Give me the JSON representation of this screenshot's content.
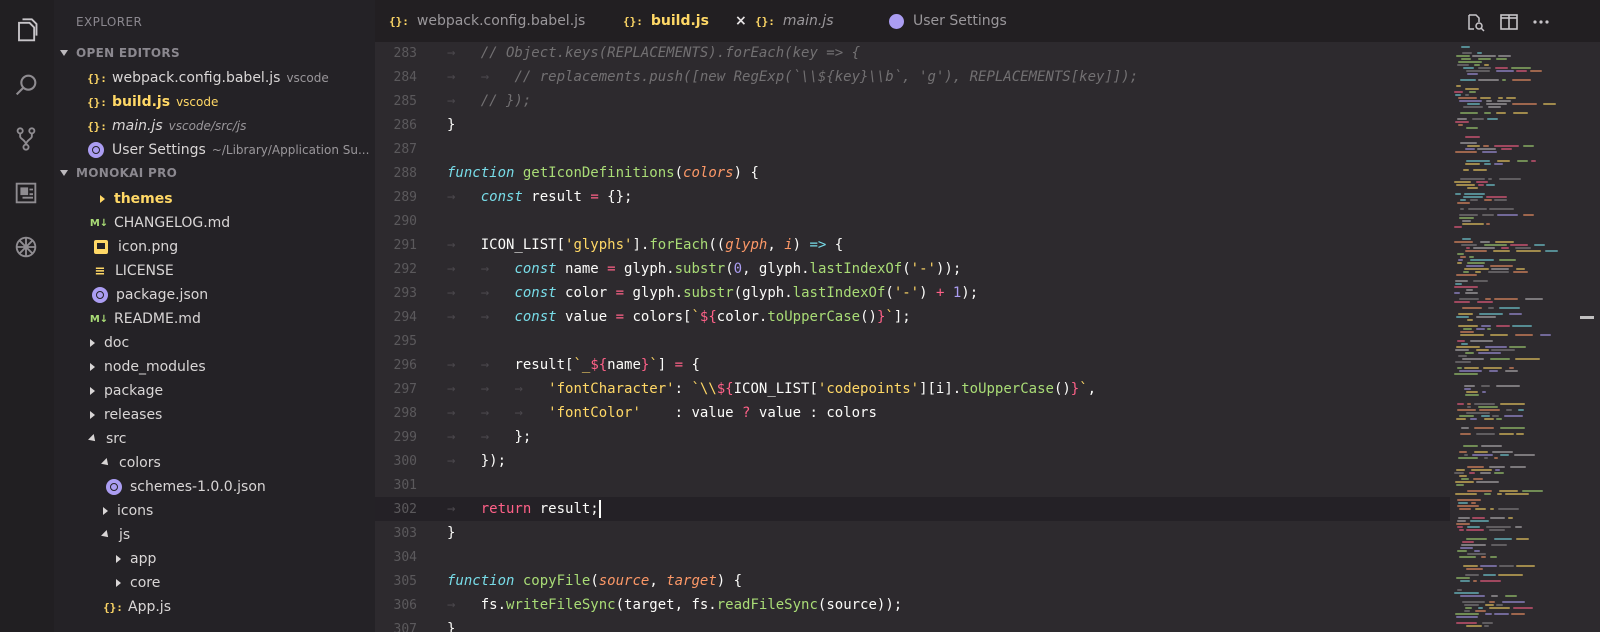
{
  "activity_bar": {
    "icons": [
      "explorer-icon",
      "search-icon",
      "source-control-icon",
      "extensions-icon",
      "debug-icon"
    ]
  },
  "sidebar": {
    "header": "EXPLORER",
    "open_editors": {
      "title": "OPEN EDITORS",
      "items": [
        {
          "icon": "js-file-icon",
          "label": "webpack.config.babel.js",
          "desc": "vscode"
        },
        {
          "icon": "js-file-icon",
          "label": "build.js",
          "desc": "vscode"
        },
        {
          "icon": "js-file-icon",
          "label": "main.js",
          "desc": "vscode/src/js"
        },
        {
          "icon": "settings-file-icon",
          "label": "User Settings",
          "desc": "~/Library/Application Su..."
        }
      ]
    },
    "project": {
      "title": "MONOKAI PRO",
      "items": [
        {
          "label": "themes",
          "icon": "folder-collapsed"
        },
        {
          "label": "CHANGELOG.md",
          "icon": "markdown-file-icon",
          "icon_text": "M↓"
        },
        {
          "label": "icon.png",
          "icon": "image-file-icon"
        },
        {
          "label": "LICENSE",
          "icon": "license-file-icon",
          "icon_text": "≡"
        },
        {
          "label": "package.json",
          "icon": "json-file-icon"
        },
        {
          "label": "README.md",
          "icon": "markdown-file-icon",
          "icon_text": "M↓"
        },
        {
          "label": "doc",
          "icon": "folder-collapsed"
        },
        {
          "label": "node_modules",
          "icon": "folder-collapsed"
        },
        {
          "label": "package",
          "icon": "folder-collapsed"
        },
        {
          "label": "releases",
          "icon": "folder-collapsed"
        },
        {
          "label": "src",
          "icon": "folder-expanded"
        },
        {
          "label": "colors",
          "icon": "folder-expanded"
        },
        {
          "label": "schemes-1.0.0.json",
          "icon": "json-file-icon"
        },
        {
          "label": "icons",
          "icon": "folder-collapsed"
        },
        {
          "label": "js",
          "icon": "folder-expanded"
        },
        {
          "label": "app",
          "icon": "folder-collapsed"
        },
        {
          "label": "core",
          "icon": "folder-collapsed"
        },
        {
          "label": "App.js",
          "icon": "js-file-icon"
        }
      ]
    },
    "js_icon_text": "{}:"
  },
  "tabs": [
    {
      "label": "webpack.config.babel.js",
      "icon": "js-file-icon"
    },
    {
      "label": "build.js",
      "icon": "js-file-icon",
      "active": true,
      "close": "×"
    },
    {
      "label": "main.js",
      "icon": "js-file-icon"
    },
    {
      "label": "User Settings",
      "icon": "settings-file-icon"
    }
  ],
  "toolbar_icons": [
    "open-changes-icon",
    "split-editor-icon",
    "more-actions-icon"
  ],
  "editor": {
    "current_line": 302,
    "lines": [
      {
        "n": 283,
        "indent": 1,
        "tokens": [
          [
            "cmt",
            "// Object.keys(REPLACEMENTS).forEach(key => {"
          ]
        ]
      },
      {
        "n": 284,
        "indent": 2,
        "tokens": [
          [
            "cmt",
            "// replacements.push([new RegExp(`\\\\${key}\\\\b`, 'g'), REPLACEMENTS[key]]);"
          ]
        ]
      },
      {
        "n": 285,
        "indent": 1,
        "tokens": [
          [
            "cmt",
            "// });"
          ]
        ]
      },
      {
        "n": 286,
        "indent": 0,
        "tokens": [
          [
            "var",
            "}"
          ]
        ]
      },
      {
        "n": 287,
        "indent": 0,
        "tokens": []
      },
      {
        "n": 288,
        "indent": 0,
        "tokens": [
          [
            "stor",
            "function"
          ],
          [
            "var",
            " "
          ],
          [
            "fn",
            "getIconDefinitions"
          ],
          [
            "var",
            "("
          ],
          [
            "param",
            "colors"
          ],
          [
            "var",
            ") {"
          ]
        ]
      },
      {
        "n": 289,
        "indent": 1,
        "tokens": [
          [
            "stor",
            "const"
          ],
          [
            "var",
            " result "
          ],
          [
            "op",
            "="
          ],
          [
            "var",
            " {};"
          ]
        ]
      },
      {
        "n": 290,
        "indent": 0,
        "tokens": []
      },
      {
        "n": 291,
        "indent": 1,
        "tokens": [
          [
            "var",
            "ICON_LIST["
          ],
          [
            "str",
            "'glyphs'"
          ],
          [
            "var",
            "]."
          ],
          [
            "fn",
            "forEach"
          ],
          [
            "var",
            "(("
          ],
          [
            "param",
            "glyph"
          ],
          [
            "var",
            ", "
          ],
          [
            "param",
            "i"
          ],
          [
            "var",
            ") "
          ],
          [
            "stor",
            "=>"
          ],
          [
            "var",
            " {"
          ]
        ]
      },
      {
        "n": 292,
        "indent": 2,
        "tokens": [
          [
            "stor",
            "const"
          ],
          [
            "var",
            " name "
          ],
          [
            "op",
            "="
          ],
          [
            "var",
            " glyph."
          ],
          [
            "fn",
            "substr"
          ],
          [
            "var",
            "("
          ],
          [
            "num",
            "0"
          ],
          [
            "var",
            ", glyph."
          ],
          [
            "fn",
            "lastIndexOf"
          ],
          [
            "var",
            "("
          ],
          [
            "str",
            "'-'"
          ],
          [
            "var",
            "));"
          ]
        ]
      },
      {
        "n": 293,
        "indent": 2,
        "tokens": [
          [
            "stor",
            "const"
          ],
          [
            "var",
            " color "
          ],
          [
            "op",
            "="
          ],
          [
            "var",
            " glyph."
          ],
          [
            "fn",
            "substr"
          ],
          [
            "var",
            "(glyph."
          ],
          [
            "fn",
            "lastIndexOf"
          ],
          [
            "var",
            "("
          ],
          [
            "str",
            "'-'"
          ],
          [
            "var",
            ") "
          ],
          [
            "op",
            "+"
          ],
          [
            "var",
            " "
          ],
          [
            "num",
            "1"
          ],
          [
            "var",
            ");"
          ]
        ]
      },
      {
        "n": 294,
        "indent": 2,
        "tokens": [
          [
            "stor",
            "const"
          ],
          [
            "var",
            " value "
          ],
          [
            "op",
            "="
          ],
          [
            "var",
            " colors["
          ],
          [
            "str",
            "`"
          ],
          [
            "op",
            "${"
          ],
          [
            "var",
            "color."
          ],
          [
            "fn",
            "toUpperCase"
          ],
          [
            "var",
            "()"
          ],
          [
            "op",
            "}"
          ],
          [
            "str",
            "`"
          ],
          [
            "var",
            "];"
          ]
        ]
      },
      {
        "n": 295,
        "indent": 0,
        "tokens": []
      },
      {
        "n": 296,
        "indent": 2,
        "tokens": [
          [
            "var",
            "result["
          ],
          [
            "str",
            "`_"
          ],
          [
            "op",
            "${"
          ],
          [
            "var",
            "name"
          ],
          [
            "op",
            "}"
          ],
          [
            "str",
            "`"
          ],
          [
            "var",
            "] "
          ],
          [
            "op",
            "="
          ],
          [
            "var",
            " {"
          ]
        ]
      },
      {
        "n": 297,
        "indent": 3,
        "tokens": [
          [
            "str",
            "'fontCharacter'"
          ],
          [
            "var",
            ": "
          ],
          [
            "str",
            "`\\\\"
          ],
          [
            "op",
            "${"
          ],
          [
            "var",
            "ICON_LIST["
          ],
          [
            "str",
            "'codepoints'"
          ],
          [
            "var",
            "][i]."
          ],
          [
            "fn",
            "toUpperCase"
          ],
          [
            "var",
            "()"
          ],
          [
            "op",
            "}"
          ],
          [
            "str",
            "`"
          ],
          [
            "var",
            ","
          ]
        ]
      },
      {
        "n": 298,
        "indent": 3,
        "tokens": [
          [
            "str",
            "'fontColor'"
          ],
          [
            "guide",
            "    "
          ],
          [
            "var",
            ": value "
          ],
          [
            "op",
            "?"
          ],
          [
            "var",
            " value : colors"
          ]
        ]
      },
      {
        "n": 299,
        "indent": 2,
        "tokens": [
          [
            "var",
            "};"
          ]
        ]
      },
      {
        "n": 300,
        "indent": 1,
        "tokens": [
          [
            "var",
            "});"
          ]
        ]
      },
      {
        "n": 301,
        "indent": 0,
        "tokens": []
      },
      {
        "n": 302,
        "indent": 1,
        "tokens": [
          [
            "kw",
            "return"
          ],
          [
            "var",
            " result;"
          ]
        ]
      },
      {
        "n": 303,
        "indent": 0,
        "tokens": [
          [
            "var",
            "}"
          ]
        ]
      },
      {
        "n": 304,
        "indent": 0,
        "tokens": []
      },
      {
        "n": 305,
        "indent": 0,
        "tokens": [
          [
            "stor",
            "function"
          ],
          [
            "var",
            " "
          ],
          [
            "fn",
            "copyFile"
          ],
          [
            "var",
            "("
          ],
          [
            "param",
            "source"
          ],
          [
            "var",
            ", "
          ],
          [
            "param",
            "target"
          ],
          [
            "var",
            ") {"
          ]
        ]
      },
      {
        "n": 306,
        "indent": 1,
        "tokens": [
          [
            "var",
            "fs."
          ],
          [
            "fn",
            "writeFileSync"
          ],
          [
            "var",
            "(target, fs."
          ],
          [
            "fn",
            "readFileSync"
          ],
          [
            "var",
            "(source));"
          ]
        ]
      },
      {
        "n": 307,
        "indent": 0,
        "tokens": [
          [
            "var",
            "}"
          ]
        ]
      }
    ]
  },
  "colors": {
    "yellow": "#ffd866",
    "green": "#a9dc76",
    "pink": "#ff6188",
    "cyan": "#78dce8",
    "orange": "#fc9867",
    "purple": "#ab9df2",
    "comment": "#727072",
    "editor_bg": "#2d2a2e",
    "sidebar_bg": "#242226"
  }
}
